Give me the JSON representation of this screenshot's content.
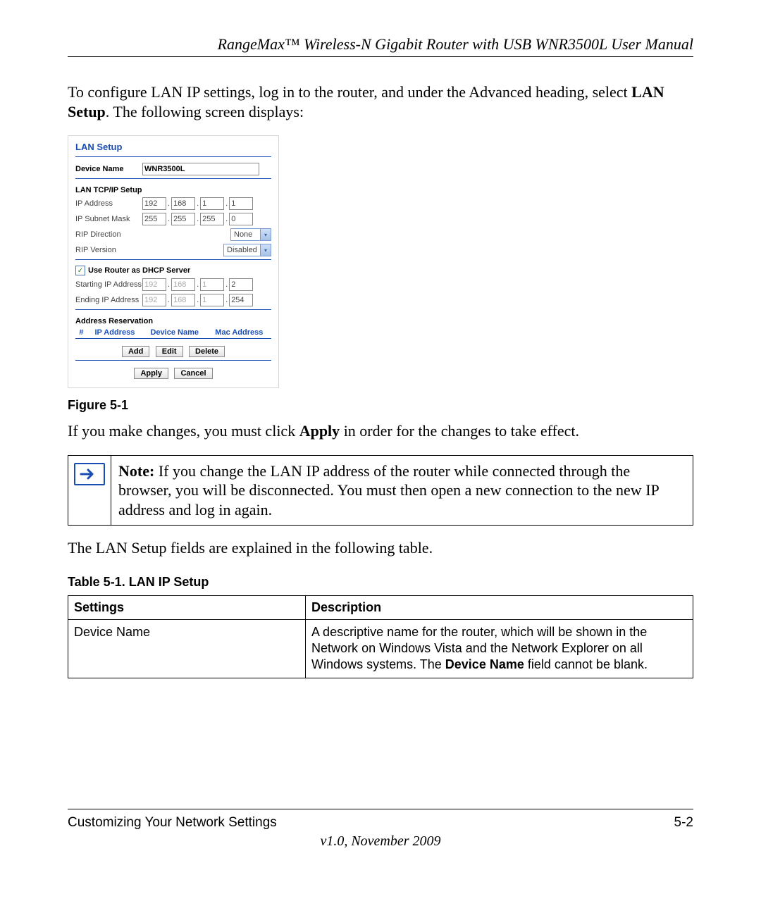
{
  "header": {
    "title": "RangeMax™ Wireless-N Gigabit Router with USB WNR3500L User Manual"
  },
  "intro": {
    "p1_prefix": "To configure LAN IP settings, log in to the router, and under the Advanced heading, select ",
    "p1_bold": "LAN Setup",
    "p1_suffix": ". The following screen displays:"
  },
  "lan_screenshot": {
    "title": "LAN Setup",
    "device_name_label": "Device Name",
    "device_name_value": "WNR3500L",
    "tcpip_heading": "LAN TCP/IP Setup",
    "ip_address_label": "IP Address",
    "ip_address": [
      "192",
      "168",
      "1",
      "1"
    ],
    "subnet_label": "IP Subnet Mask",
    "subnet": [
      "255",
      "255",
      "255",
      "0"
    ],
    "rip_direction_label": "RIP Direction",
    "rip_direction_value": "None",
    "rip_version_label": "RIP Version",
    "rip_version_value": "Disabled",
    "dhcp_checkbox_label": "Use Router as DHCP Server",
    "starting_ip_label": "Starting IP Address",
    "starting_ip": [
      "192",
      "168",
      "1",
      "2"
    ],
    "ending_ip_label": "Ending IP Address",
    "ending_ip": [
      "192",
      "168",
      "1",
      "254"
    ],
    "reservation_heading": "Address Reservation",
    "res_headers": [
      "#",
      "IP Address",
      "Device Name",
      "Mac Address"
    ],
    "btn_add": "Add",
    "btn_edit": "Edit",
    "btn_delete": "Delete",
    "btn_apply": "Apply",
    "btn_cancel": "Cancel"
  },
  "figure_caption": "Figure 5-1",
  "apply_sentence": {
    "prefix": "If you make changes, you must click ",
    "bold": "Apply",
    "suffix": " in order for the changes to take effect."
  },
  "note": {
    "label": "Note:",
    "text": " If you change the LAN IP address of the router while connected through the browser, you will be disconnected. You must then open a new connection to the new IP address and log in again."
  },
  "table_intro": "The LAN Setup fields are explained in the following table.",
  "table_caption": "Table 5-1.  LAN IP Setup",
  "lan_table": {
    "headers": [
      "Settings",
      "Description"
    ],
    "row1_setting": "Device Name",
    "row1_desc_prefix": "A descriptive name for the router, which will be shown in the Network on Windows Vista and the Network Explorer on all Windows systems. The ",
    "row1_desc_bold": "Device Name",
    "row1_desc_suffix": " field cannot be blank."
  },
  "footer": {
    "section": "Customizing Your Network Settings",
    "page": "5-2",
    "version": "v1.0, November 2009"
  }
}
